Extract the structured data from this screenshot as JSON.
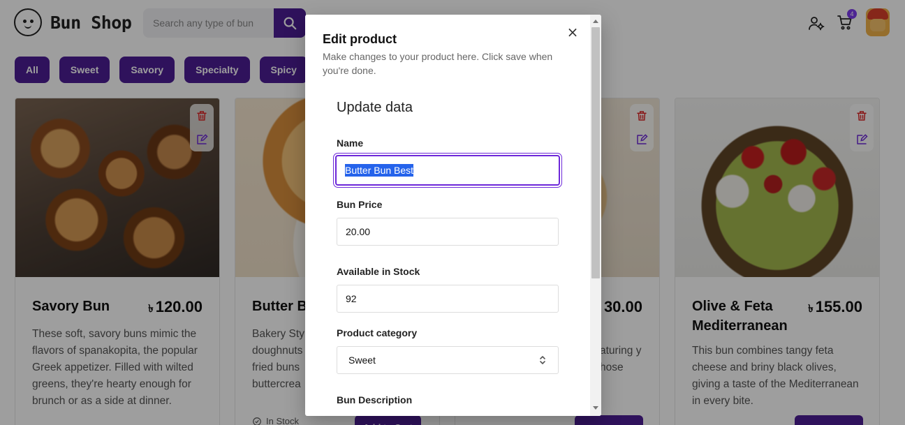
{
  "header": {
    "logo_text": "Bun Shop",
    "search_placeholder": "Search any type of bun",
    "cart_count": "4"
  },
  "filters": [
    "All",
    "Sweet",
    "Savory",
    "Specialty",
    "Spicy"
  ],
  "products": [
    {
      "title": "Savory Bun",
      "currency": "৳",
      "price": "120.00",
      "description": "These soft, savory buns mimic the flavors of spanakopita, the popular Greek appetizer. Filled with wilted greens, they're hearty enough for brunch or as a side at dinner."
    },
    {
      "title": "Butter B",
      "description": "Bakery Styl doughnuts fried buns buttercrea",
      "stock": "In Stock",
      "add_to_cart": "Add to Cart"
    },
    {
      "price": "30.00",
      "description": "aturing y hose"
    },
    {
      "title": "Olive & Feta Mediterranean",
      "currency": "৳",
      "price": "155.00",
      "description": "This bun combines tangy feta cheese and briny black olives, giving a taste of the Mediterranean in every bite."
    }
  ],
  "modal": {
    "title": "Edit product",
    "subtitle": "Make changes to your product here. Click save when you're done.",
    "section_title": "Update data",
    "fields": {
      "name_label": "Name",
      "name_value": "Butter Bun Best",
      "price_label": "Bun Price",
      "price_value": "20.00",
      "stock_label": "Available in Stock",
      "stock_value": "92",
      "category_label": "Product category",
      "category_value": "Sweet",
      "description_label": "Bun Description"
    }
  },
  "colors": {
    "accent": "#4c1d95",
    "focus_ring": "#6d28d9",
    "overlay": "rgba(0,0,0,0.38)"
  }
}
